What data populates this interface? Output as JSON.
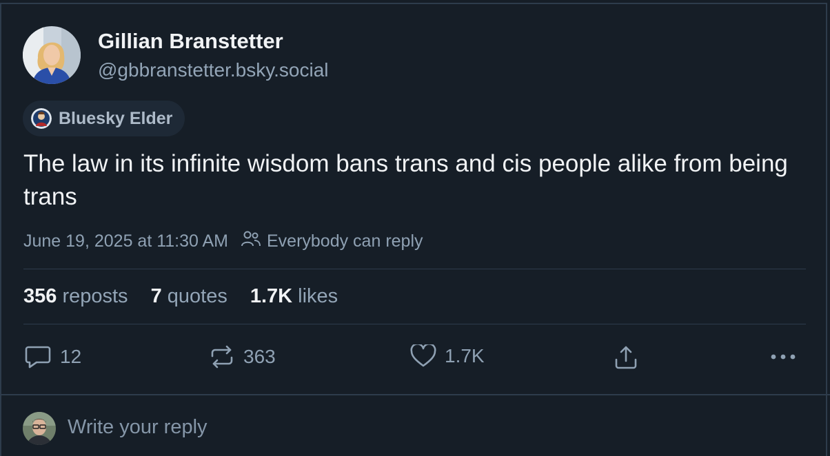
{
  "author": {
    "display_name": "Gillian Branstetter",
    "handle": "@gbbranstetter.bsky.social"
  },
  "badge": {
    "label": "Bluesky Elder"
  },
  "post": {
    "text": "The law in its infinite wisdom bans trans and cis people alike from being trans",
    "timestamp": "June 19, 2025 at 11:30 AM",
    "reply_setting": "Everybody can reply"
  },
  "stats": {
    "reposts_count": "356",
    "reposts_label": "reposts",
    "quotes_count": "7",
    "quotes_label": "quotes",
    "likes_count": "1.7K",
    "likes_label": "likes"
  },
  "actions": {
    "reply_count": "12",
    "repost_count": "363",
    "like_count": "1.7K"
  },
  "composer": {
    "placeholder": "Write your reply"
  },
  "colors": {
    "background": "#161e27",
    "border": "#2e3c4c",
    "text_primary": "#f1f3f5",
    "text_secondary": "#93a5b7"
  }
}
